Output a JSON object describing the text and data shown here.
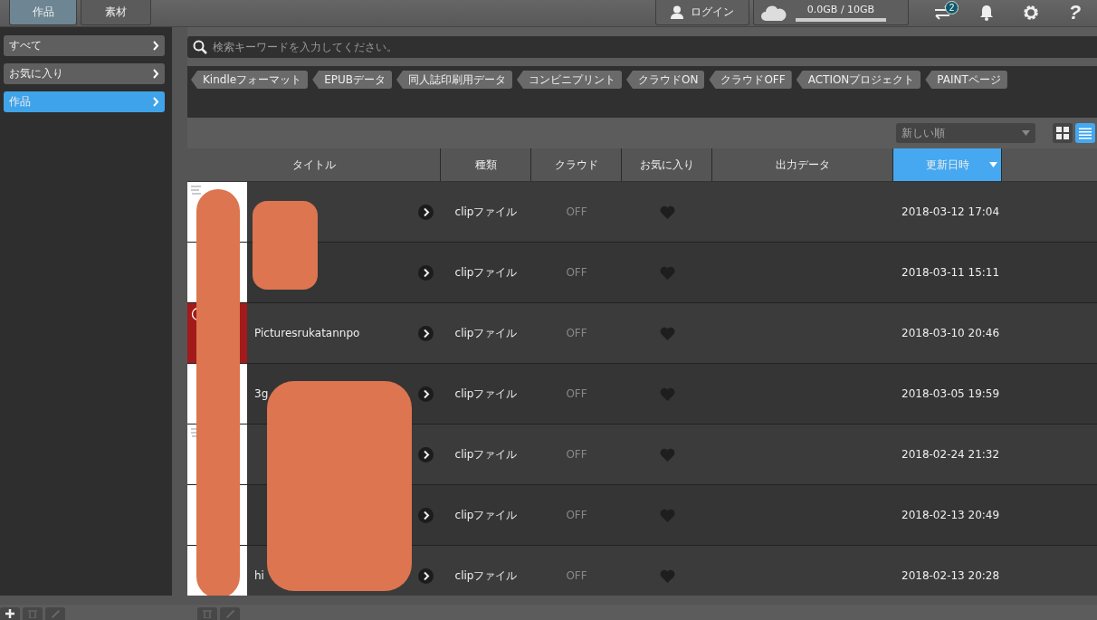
{
  "top_tabs": [
    {
      "label": "作品",
      "selected": true
    },
    {
      "label": "素材",
      "selected": false
    }
  ],
  "login": {
    "label": "ログイン"
  },
  "storage": {
    "label": "0.0GB / 10GB",
    "level": 0.0
  },
  "transfer_badge": "2",
  "help": "?",
  "sidebar": {
    "items": [
      {
        "label": "すべて",
        "selected": false
      },
      {
        "label": "お気に入り",
        "selected": false
      },
      {
        "label": "作品",
        "selected": true
      }
    ]
  },
  "search": {
    "placeholder": "検索キーワードを入力してください。"
  },
  "tags": [
    "Kindleフォーマット",
    "EPUBデータ",
    "同人誌印刷用データ",
    "コンビニプリント",
    "クラウドON",
    "クラウドOFF",
    "ACTIONプロジェクト",
    "PAINTページ"
  ],
  "sort": {
    "value": "新しい順"
  },
  "view_modes": [
    {
      "kind": "grid",
      "selected": false
    },
    {
      "kind": "list",
      "selected": true
    }
  ],
  "table": {
    "columns": [
      {
        "label": "タイトル",
        "sorted": false
      },
      {
        "label": "種類",
        "sorted": false
      },
      {
        "label": "クラウド",
        "sorted": false
      },
      {
        "label": "お気に入り",
        "sorted": false
      },
      {
        "label": "出力データ",
        "sorted": false
      },
      {
        "label": "更新日時",
        "sorted": true
      }
    ],
    "rows": [
      {
        "kind": "sketch",
        "type": "clipファイル",
        "cloud": "OFF",
        "favorite": false,
        "updated": "2018-03-12 17:04"
      },
      {
        "kind": "blank",
        "type": "clipファイル",
        "cloud": "OFF",
        "favorite": false,
        "updated": "2018-03-11 15:11"
      },
      {
        "kind": "error",
        "title": "Picturesrukatannpo",
        "type": "clipファイル",
        "cloud": "OFF",
        "favorite": false,
        "updated": "2018-03-10 20:46"
      },
      {
        "kind": "blank",
        "title": "3g",
        "type": "clipファイル",
        "cloud": "OFF",
        "favorite": false,
        "updated": "2018-03-05 19:59"
      },
      {
        "kind": "sketch",
        "type": "clipファイル",
        "cloud": "OFF",
        "favorite": false,
        "updated": "2018-02-24 21:32"
      },
      {
        "kind": "blank",
        "type": "clipファイル",
        "cloud": "OFF",
        "favorite": false,
        "updated": "2018-02-13 20:49"
      },
      {
        "kind": "blank",
        "title": "hi",
        "type": "clipファイル",
        "cloud": "OFF",
        "favorite": false,
        "updated": "2018-02-13 20:28"
      }
    ]
  }
}
